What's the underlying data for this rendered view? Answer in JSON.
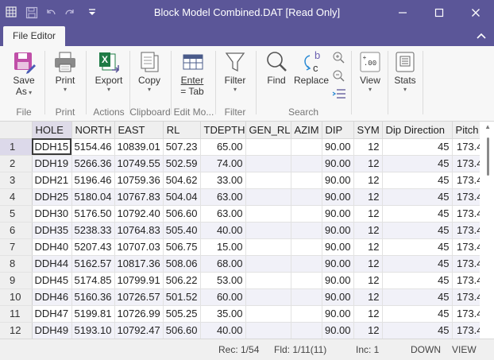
{
  "window": {
    "title": "Block Model Combined.DAT [Read Only]",
    "minimize": "—",
    "maximize": "☐",
    "close": "✕"
  },
  "quick_access": {
    "icons": [
      "grid-icon",
      "save-icon",
      "undo-icon",
      "redo-icon",
      "customize-icon"
    ]
  },
  "ribbon": {
    "active_tab": "File Editor",
    "buttons": {
      "save": "Save\nAs",
      "save_l1": "Save",
      "save_l2": "As",
      "print": "Print",
      "export": "Export",
      "copy": "Copy",
      "enter_l1": "Enter",
      "enter_l2": "= Tab",
      "filter": "Filter",
      "find": "Find",
      "replace": "Replace",
      "view": "View",
      "stats": "Stats"
    },
    "groups": {
      "file": "File",
      "print": "Print",
      "actions": "Actions",
      "clipboard": "Clipboard",
      "edit": "Edit Mo...",
      "filter": "Filter",
      "search": "Search"
    }
  },
  "grid": {
    "columns": [
      "HOLE",
      "NORTH",
      "EAST",
      "RL",
      "TDEPTH",
      "GEN_RL",
      "AZIM",
      "DIP",
      "SYM",
      "Dip Direction",
      "Pitch"
    ],
    "rows": [
      {
        "n": "1",
        "cells": [
          "DDH15",
          "5154.46",
          "10839.01",
          "507.23",
          "65.00",
          "",
          "",
          "90.00",
          "12",
          "45",
          "173.4"
        ]
      },
      {
        "n": "2",
        "cells": [
          "DDH19",
          "5266.36",
          "10749.55",
          "502.59",
          "74.00",
          "",
          "",
          "90.00",
          "12",
          "45",
          "173.4"
        ]
      },
      {
        "n": "3",
        "cells": [
          "DDH21",
          "5196.46",
          "10759.36",
          "504.62",
          "33.00",
          "",
          "",
          "90.00",
          "12",
          "45",
          "173.4"
        ]
      },
      {
        "n": "4",
        "cells": [
          "DDH25",
          "5180.04",
          "10767.83",
          "504.04",
          "63.00",
          "",
          "",
          "90.00",
          "12",
          "45",
          "173.4"
        ]
      },
      {
        "n": "5",
        "cells": [
          "DDH30",
          "5176.50",
          "10792.40",
          "506.60",
          "63.00",
          "",
          "",
          "90.00",
          "12",
          "45",
          "173.4"
        ]
      },
      {
        "n": "6",
        "cells": [
          "DDH35",
          "5238.33",
          "10764.83",
          "505.40",
          "40.00",
          "",
          "",
          "90.00",
          "12",
          "45",
          "173.4"
        ]
      },
      {
        "n": "7",
        "cells": [
          "DDH40",
          "5207.43",
          "10707.03",
          "506.75",
          "15.00",
          "",
          "",
          "90.00",
          "12",
          "45",
          "173.4"
        ]
      },
      {
        "n": "8",
        "cells": [
          "DDH44",
          "5162.57",
          "10817.36",
          "508.06",
          "68.00",
          "",
          "",
          "90.00",
          "12",
          "45",
          "173.4"
        ]
      },
      {
        "n": "9",
        "cells": [
          "DDH45",
          "5174.85",
          "10799.91",
          "506.22",
          "53.00",
          "",
          "",
          "90.00",
          "12",
          "45",
          "173.4"
        ]
      },
      {
        "n": "10",
        "cells": [
          "DDH46",
          "5160.36",
          "10726.57",
          "501.52",
          "60.00",
          "",
          "",
          "90.00",
          "12",
          "45",
          "173.4"
        ]
      },
      {
        "n": "11",
        "cells": [
          "DDH47",
          "5199.81",
          "10726.99",
          "505.25",
          "35.00",
          "",
          "",
          "90.00",
          "12",
          "45",
          "173.4"
        ]
      },
      {
        "n": "12",
        "cells": [
          "DDH49",
          "5193.10",
          "10792.47",
          "506.60",
          "40.00",
          "",
          "",
          "90.00",
          "12",
          "45",
          "173.4"
        ]
      }
    ]
  },
  "status": {
    "rec": "Rec: 1/54",
    "fld": "Fld: 1/11(11)",
    "inc": "Inc: 1",
    "direction": "DOWN",
    "mode": "VIEW"
  },
  "colors": {
    "titlebar": "#5b5698",
    "accent": "#6a5fb0",
    "excel_green": "#1e7b45"
  }
}
